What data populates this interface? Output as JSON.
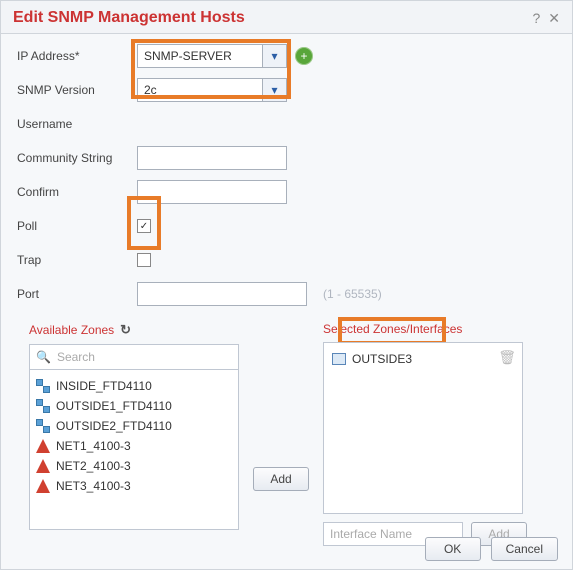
{
  "header": {
    "title": "Edit SNMP Management Hosts"
  },
  "form": {
    "ip_label": "IP Address*",
    "ip_value": "SNMP-SERVER",
    "version_label": "SNMP Version",
    "version_value": "2c",
    "username_label": "Username",
    "community_label": "Community String",
    "confirm_label": "Confirm",
    "poll_label": "Poll",
    "trap_label": "Trap",
    "poll_checked": "✓",
    "port_label": "Port",
    "port_hint": "(1 - 65535)"
  },
  "zones": {
    "available_title": "Available Zones",
    "search_placeholder": "Search",
    "items": [
      {
        "icon": "stack",
        "label": "INSIDE_FTD4110"
      },
      {
        "icon": "stack",
        "label": "OUTSIDE1_FTD4110"
      },
      {
        "icon": "stack",
        "label": "OUTSIDE2_FTD4110"
      },
      {
        "icon": "net",
        "label": "NET1_4100-3"
      },
      {
        "icon": "net",
        "label": "NET2_4100-3"
      },
      {
        "icon": "net",
        "label": "NET3_4100-3"
      }
    ],
    "add_button": "Add",
    "selected_title": "Selected Zones/Interfaces",
    "selected_items": [
      {
        "label": "OUTSIDE3"
      }
    ],
    "iface_placeholder": "Interface Name",
    "iface_add": "Add"
  },
  "footer": {
    "ok": "OK",
    "cancel": "Cancel"
  }
}
